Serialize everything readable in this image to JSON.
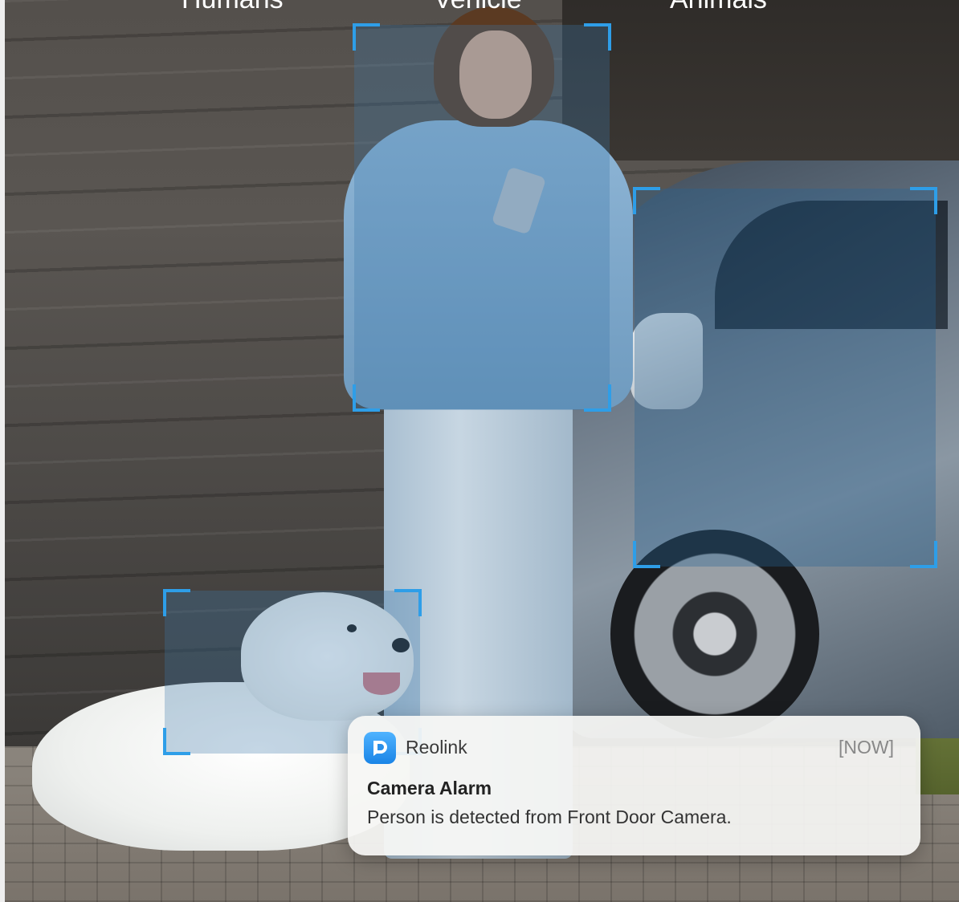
{
  "header": {
    "labels": [
      "Humans",
      "Vehicle",
      "Animals"
    ]
  },
  "detections": {
    "box_color": "#2e9ee8",
    "items": [
      "person",
      "vehicle",
      "animal"
    ]
  },
  "notification": {
    "app_name": "Reolink",
    "app_icon": "reolink-app-icon",
    "time": "[NOW]",
    "title": "Camera Alarm",
    "body": "Person is detected from Front Door Camera."
  }
}
